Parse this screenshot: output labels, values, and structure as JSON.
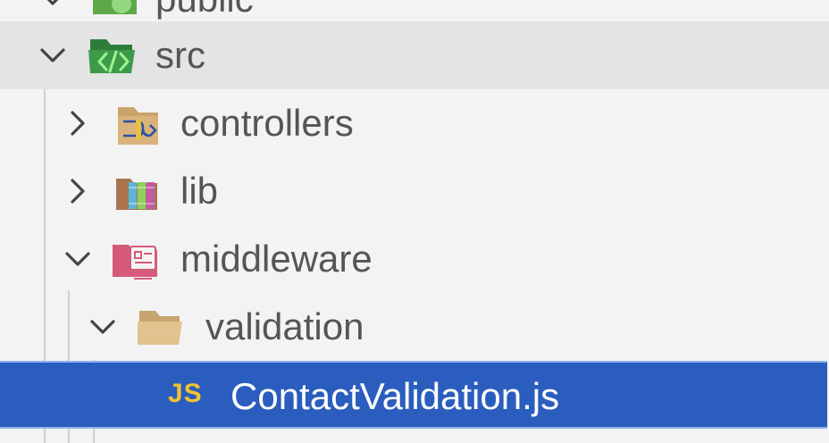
{
  "tree": {
    "items": [
      {
        "label": "public",
        "expanded": true,
        "icon": "public-folder-icon"
      },
      {
        "label": "src",
        "expanded": true,
        "icon": "src-folder-icon"
      },
      {
        "label": "controllers",
        "expanded": false,
        "icon": "controllers-folder-icon"
      },
      {
        "label": "lib",
        "expanded": false,
        "icon": "lib-folder-icon"
      },
      {
        "label": "middleware",
        "expanded": true,
        "icon": "middleware-folder-icon"
      },
      {
        "label": "validation",
        "expanded": true,
        "icon": "folder-open-icon"
      },
      {
        "label": "ContactValidation.js",
        "badge": "JS",
        "selected": true,
        "icon": "javascript-file-icon"
      }
    ]
  },
  "colors": {
    "background": "#f3f3f3",
    "hover_row": "#e4e4e4",
    "selection": "#2a5dbd",
    "selection_border": "#8fb3ee",
    "label_text": "#555555",
    "js_badge": "#f2c230"
  }
}
